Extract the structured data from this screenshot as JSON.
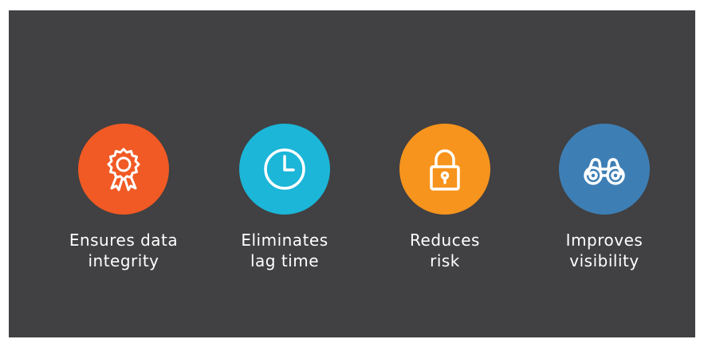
{
  "features": [
    {
      "icon": "award-ribbon-icon",
      "color": "#F15A24",
      "label_line1": "Ensures data",
      "label_line2": "integrity"
    },
    {
      "icon": "clock-icon",
      "color": "#1BB6D8",
      "label_line1": "Eliminates",
      "label_line2": "lag time"
    },
    {
      "icon": "padlock-icon",
      "color": "#F7941D",
      "label_line1": "Reduces",
      "label_line2": "risk"
    },
    {
      "icon": "binoculars-icon",
      "color": "#3D7FB5",
      "label_line1": "Improves",
      "label_line2": "visibility"
    }
  ]
}
